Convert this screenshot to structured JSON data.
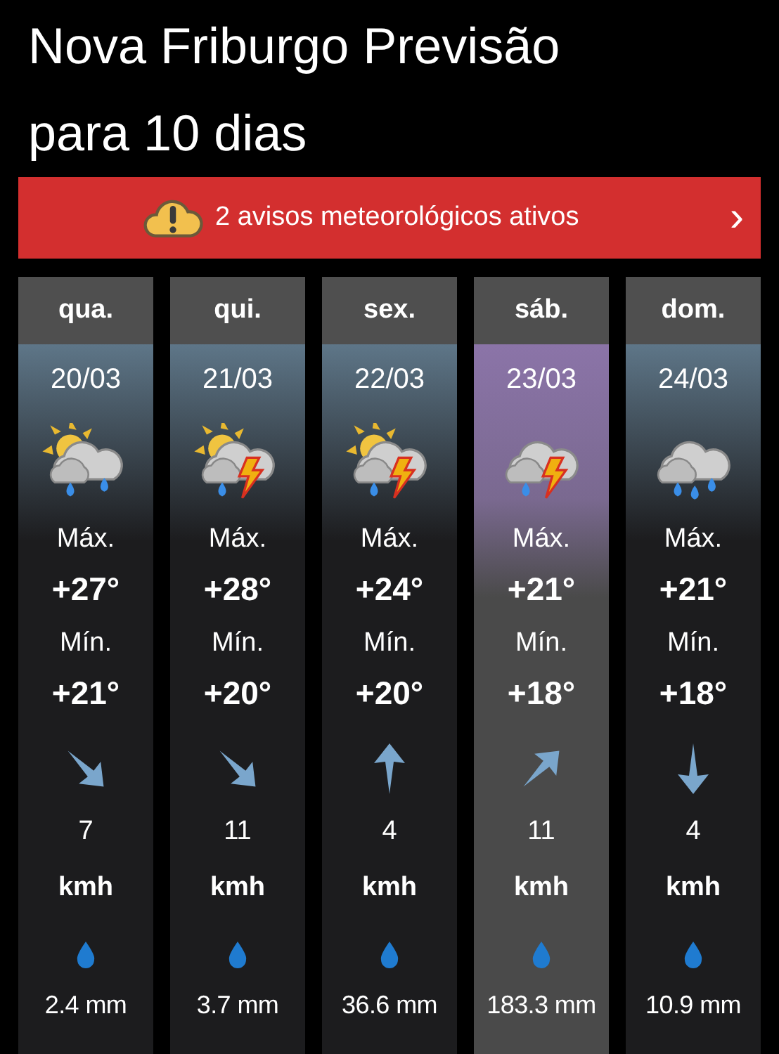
{
  "title": "Nova Friburgo Previsão para 10 dias",
  "alert": {
    "text": "2 avisos meteorológicos ativos",
    "chevron": "›"
  },
  "days": [
    {
      "weekday": "qua.",
      "date": "20/03",
      "selected": false,
      "weather": {
        "kind": "sun_cloud_rain"
      },
      "max_label": "Máx.",
      "max": "+27°",
      "min_label": "Mín.",
      "min": "+21°",
      "wind_arrow": {
        "kind": "SE"
      },
      "wind_speed": "7",
      "wind_unit": "kmh",
      "precipitation": "2.4 mm"
    },
    {
      "weekday": "qui.",
      "date": "21/03",
      "selected": false,
      "weather": {
        "kind": "sun_cloud_storm"
      },
      "max_label": "Máx.",
      "max": "+28°",
      "min_label": "Mín.",
      "min": "+20°",
      "wind_arrow": {
        "kind": "SE"
      },
      "wind_speed": "11",
      "wind_unit": "kmh",
      "precipitation": "3.7 mm"
    },
    {
      "weekday": "sex.",
      "date": "22/03",
      "selected": false,
      "weather": {
        "kind": "sun_cloud_storm"
      },
      "max_label": "Máx.",
      "max": "+24°",
      "min_label": "Mín.",
      "min": "+20°",
      "wind_arrow": {
        "kind": "N"
      },
      "wind_speed": "4",
      "wind_unit": "kmh",
      "precipitation": "36.6 mm"
    },
    {
      "weekday": "sáb.",
      "date": "23/03",
      "selected": true,
      "weather": {
        "kind": "cloud_storm"
      },
      "max_label": "Máx.",
      "max": "+21°",
      "min_label": "Mín.",
      "min": "+18°",
      "wind_arrow": {
        "kind": "NE"
      },
      "wind_speed": "11",
      "wind_unit": "kmh",
      "precipitation": "183.3 mm"
    },
    {
      "weekday": "dom.",
      "date": "24/03",
      "selected": false,
      "weather": {
        "kind": "cloud_rain"
      },
      "max_label": "Máx.",
      "max": "+21°",
      "min_label": "Mín.",
      "min": "+18°",
      "wind_arrow": {
        "kind": "S"
      },
      "wind_speed": "4",
      "wind_unit": "kmh",
      "precipitation": "10.9 mm"
    }
  ]
}
